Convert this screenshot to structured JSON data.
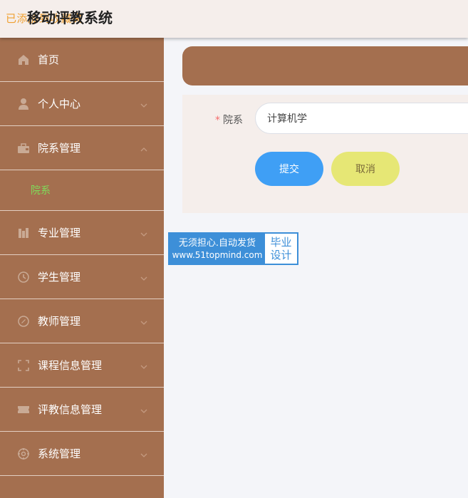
{
  "header": {
    "overlay_text": "已添加到收藏夹",
    "title": "移动评教系统"
  },
  "sidebar": {
    "items": [
      {
        "label": "首页",
        "icon": "home-icon",
        "arrow": ""
      },
      {
        "label": "个人中心",
        "icon": "user-icon",
        "arrow": "down"
      },
      {
        "label": "院系管理",
        "icon": "briefcase-icon",
        "arrow": "up"
      },
      {
        "label": "专业管理",
        "icon": "bar-chart-icon",
        "arrow": "down"
      },
      {
        "label": "学生管理",
        "icon": "clock-icon",
        "arrow": "down"
      },
      {
        "label": "教师管理",
        "icon": "compass-icon",
        "arrow": "down"
      },
      {
        "label": "课程信息管理",
        "icon": "fullscreen-icon",
        "arrow": "down"
      },
      {
        "label": "评教信息管理",
        "icon": "ticket-icon",
        "arrow": "down"
      },
      {
        "label": "系统管理",
        "icon": "settings-icon",
        "arrow": "down"
      }
    ],
    "submenu": {
      "label": "院系"
    }
  },
  "form": {
    "label": "院系",
    "required_mark": "*",
    "value": "计算机学",
    "submit_label": "提交",
    "cancel_label": "取消"
  },
  "badge": {
    "line1": "无须担心.自动发货",
    "line2": "www.51topmind.com",
    "right1": "毕业",
    "right2": "设计"
  },
  "colors": {
    "sidebar_bg": "#a46f4f",
    "header_bg": "#f5eeeb",
    "submit_btn": "#3f9ff5",
    "cancel_btn": "#e6e775",
    "submenu_active": "#7fdc5a"
  }
}
